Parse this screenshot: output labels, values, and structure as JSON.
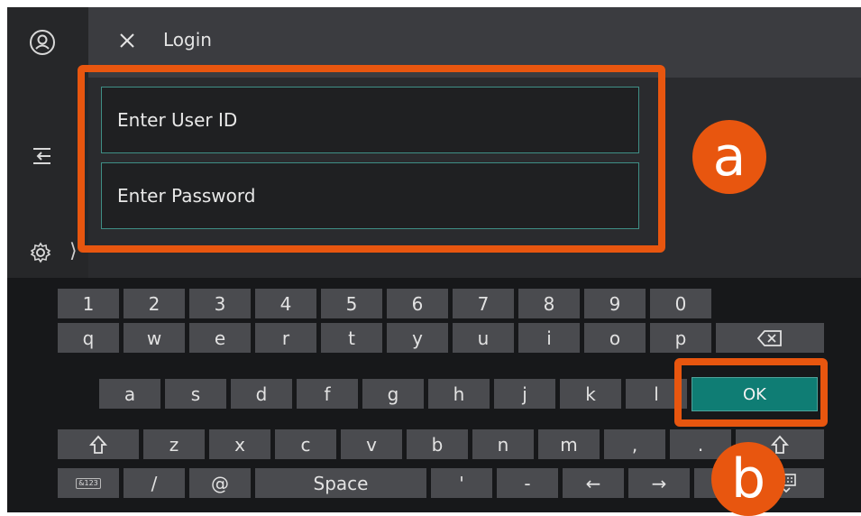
{
  "dialog": {
    "title": "Login",
    "close_icon": "close-icon"
  },
  "sidebar": {
    "icons": [
      "user-icon",
      "login-arrow-icon",
      "gear-icon"
    ],
    "chevron": "⟩"
  },
  "form": {
    "user_id_placeholder": "Enter User ID",
    "password_placeholder": "Enter Password"
  },
  "keyboard": {
    "row1": [
      "1",
      "2",
      "3",
      "4",
      "5",
      "6",
      "7",
      "8",
      "9",
      "0"
    ],
    "row2": [
      "q",
      "w",
      "e",
      "r",
      "t",
      "y",
      "u",
      "i",
      "o",
      "p"
    ],
    "row3": [
      "a",
      "s",
      "d",
      "f",
      "g",
      "h",
      "j",
      "k",
      "l"
    ],
    "row4": [
      "z",
      "x",
      "c",
      "v",
      "b",
      "n",
      "m",
      ",",
      "."
    ],
    "row5": [
      "&123",
      "/",
      "@",
      "Space",
      "'",
      "-",
      "←",
      "→"
    ],
    "ok_label": "OK",
    "backspace_icon": "backspace-icon",
    "shift_icon": "shift-icon",
    "keyboard_icon": "keyboard-hide-icon"
  },
  "annotations": {
    "a": "a",
    "b": "b",
    "color": "#e8560f"
  },
  "colors": {
    "accent": "#0f7d74",
    "field_border": "#3f8f86"
  }
}
